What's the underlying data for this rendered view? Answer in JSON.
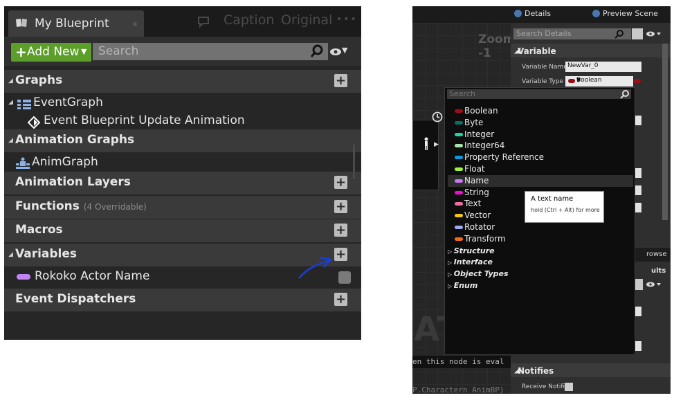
{
  "blueprint_panel": {
    "tab_title": "My Blueprint",
    "ghost_tabs": [
      "Caption",
      "Original"
    ],
    "add_new_label": "Add New",
    "search_placeholder": "Search",
    "sections": [
      {
        "label": "Graphs",
        "kind": "header",
        "expanded": true,
        "has_add": true
      },
      {
        "label": "EventGraph",
        "kind": "graph",
        "icon": "graph-icon"
      },
      {
        "label": "Event Blueprint Update Animation",
        "kind": "event",
        "icon": "event-diamond-icon"
      },
      {
        "label": "Animation Graphs",
        "kind": "header",
        "expanded": true,
        "has_add": false
      },
      {
        "label": "AnimGraph",
        "kind": "graph",
        "icon": "anim-graph-icon"
      },
      {
        "label": "Animation Layers",
        "kind": "header",
        "expanded": false,
        "has_add": true
      },
      {
        "label": "Functions",
        "sub_label": "(4 Overridable)",
        "kind": "header",
        "expanded": false,
        "has_add": true
      },
      {
        "label": "Macros",
        "kind": "header",
        "expanded": false,
        "has_add": true
      },
      {
        "label": "Variables",
        "kind": "header",
        "expanded": true,
        "has_add": true
      },
      {
        "label": "Rokoko Actor Name",
        "kind": "variable",
        "pill_color": "#c084f5"
      },
      {
        "label": "Event Dispatchers",
        "kind": "header",
        "expanded": false,
        "has_add": true
      }
    ]
  },
  "details_panel": {
    "tabs": [
      {
        "label": "Details",
        "icon": "info-icon"
      },
      {
        "label": "Preview Scene",
        "icon": "info-icon"
      }
    ],
    "search_placeholder": "Search Details",
    "variable_section": "Variable",
    "variable_name_label": "Variable Name",
    "variable_name_value": "NewVar_0",
    "variable_type_label": "Variable Type",
    "variable_type_value": "Boolean",
    "variable_type_color": "#9e0d14",
    "notifies_section": "Notifies",
    "receive_notify_label": "Receive Notifi",
    "partial_texts": [
      "rowse",
      "ults"
    ]
  },
  "graph_view": {
    "zoom_label": "Zoom -1",
    "node_text": "en this node is eval",
    "bp_text": "P.Charactern_AnimBP)",
    "watermark": "AT"
  },
  "type_dropdown": {
    "search_placeholder": "Search",
    "items": [
      {
        "label": "Boolean",
        "color": "#9e0d14"
      },
      {
        "label": "Byte",
        "color": "#0a6e60"
      },
      {
        "label": "Integer",
        "color": "#1ed6a6"
      },
      {
        "label": "Integer64",
        "color": "#a8e4a8"
      },
      {
        "label": "Property Reference",
        "color": "#0a9be0"
      },
      {
        "label": "Float",
        "color": "#a0f23a"
      },
      {
        "label": "Name",
        "color": "#c878f0",
        "selected": true
      },
      {
        "label": "String",
        "color": "#f00ed0"
      },
      {
        "label": "Text",
        "color": "#ee6fa0"
      },
      {
        "label": "Vector",
        "color": "#f5c816"
      },
      {
        "label": "Rotator",
        "color": "#9eaaf5"
      },
      {
        "label": "Transform",
        "color": "#f06a1a"
      }
    ],
    "categories": [
      "Structure",
      "Interface",
      "Object Types",
      "Enum"
    ],
    "tooltip_title": "A text name",
    "tooltip_hint": "hold (Ctrl + Alt) for more"
  }
}
